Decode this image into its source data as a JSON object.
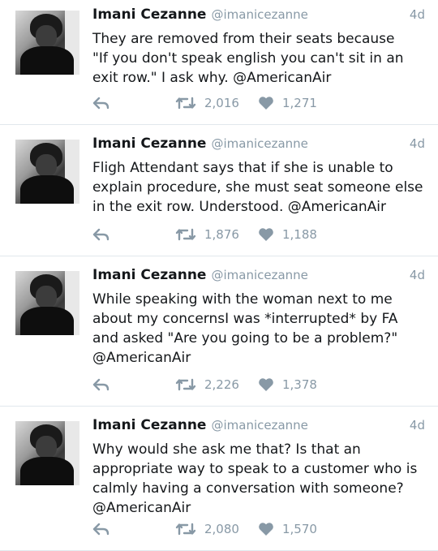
{
  "tweets": [
    {
      "name": "Imani Cezanne",
      "handle": "@imanicezanne",
      "time": "4d",
      "text": "They are removed from their seats because\n\"If you don't speak english you can't sit in an\nexit row.\" I ask why. @AmericanAir",
      "retweets": "2,016",
      "likes": "1,271"
    },
    {
      "name": "Imani Cezanne",
      "handle": "@imanicezanne",
      "time": "4d",
      "text": "Fligh Attendant says that if she is unable to\nexplain procedure, she must seat someone else\nin the exit row. Understood. @AmericanAir",
      "retweets": "1,876",
      "likes": "1,188"
    },
    {
      "name": "Imani Cezanne",
      "handle": "@imanicezanne",
      "time": "4d",
      "text": "While speaking with the woman next to me\nabout my concernsI was *interrupted* by FA\nand asked \"Are you going to be a problem?\"\n@AmericanAir",
      "retweets": "2,226",
      "likes": "1,378"
    },
    {
      "name": "Imani Cezanne",
      "handle": "@imanicezanne",
      "time": "4d",
      "text": "Why would she ask me that? Is that an\nappropriate way to speak to a customer who is\ncalmly having a conversation with someone?\n@AmericanAir",
      "retweets": "2,080",
      "likes": "1,570"
    }
  ],
  "icons": {
    "reply": "reply-icon",
    "retweet": "retweet-icon",
    "like": "heart-icon"
  },
  "colors": {
    "text": "#14171a",
    "muted": "#8899a6",
    "divider": "#e1e8ed"
  }
}
